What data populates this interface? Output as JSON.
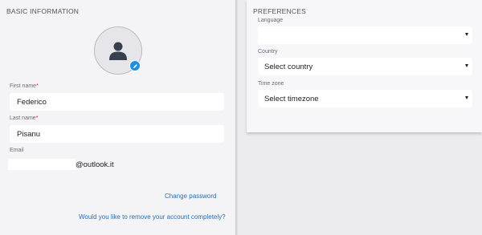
{
  "basic_info": {
    "title": "BASIC INFORMATION",
    "first_name": {
      "label": "First name",
      "required": "*",
      "value": "Federico"
    },
    "last_name": {
      "label": "Last name",
      "required": "*",
      "value": "Pisanu"
    },
    "email": {
      "label": "Email",
      "value": "@outlook.it"
    },
    "change_password": "Change password",
    "remove_account": "Would you like to remove your account completely?"
  },
  "preferences": {
    "title": "PREFERENCES",
    "language": {
      "label": "Language",
      "value": ""
    },
    "country": {
      "label": "Country",
      "value": "Select country"
    },
    "timezone": {
      "label": "Time zone",
      "value": "Select timezone"
    }
  },
  "colors": {
    "accent": "#1d8fdc",
    "link": "#2a6fb0",
    "required": "#d02020"
  }
}
